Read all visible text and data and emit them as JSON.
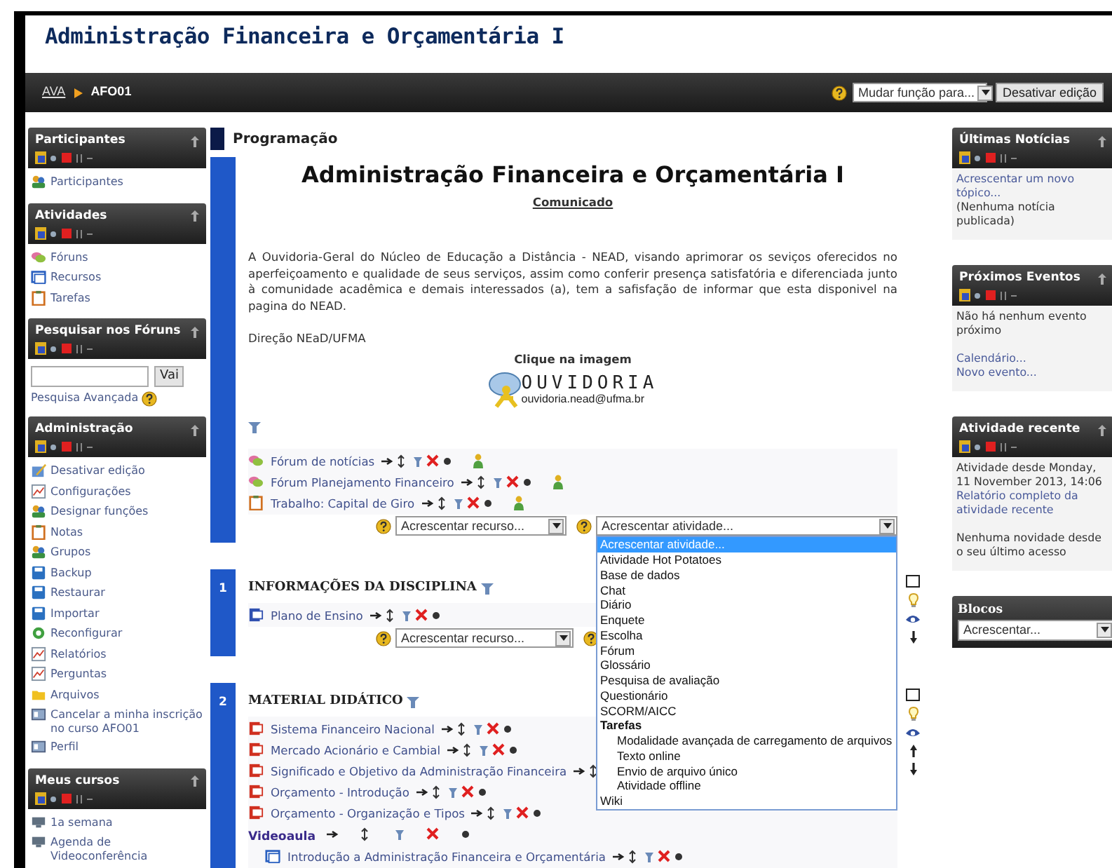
{
  "page_title": "Administração Financeira e Orçamentária I",
  "breadcrumb": [
    {
      "label": "AVA",
      "link": true
    },
    {
      "label": "AFO01",
      "link": false
    }
  ],
  "role_select": "Mudar função para...",
  "edit_button": "Desativar edição",
  "left_blocks": [
    {
      "title": "Participantes",
      "kind": "links",
      "items": [
        {
          "label": "Participantes",
          "kind": "people"
        }
      ]
    },
    {
      "title": "Atividades",
      "kind": "links",
      "items": [
        {
          "label": "Fóruns",
          "kind": "forum"
        },
        {
          "label": "Recursos",
          "kind": "resource"
        },
        {
          "label": "Tarefas",
          "kind": "clipboard"
        }
      ]
    },
    {
      "title": "Pesquisar nos Fóruns",
      "kind": "search",
      "button": "Vai",
      "link": "Pesquisa Avançada"
    },
    {
      "title": "Administração",
      "kind": "links",
      "items": [
        {
          "label": "Desativar edição",
          "kind": "pencil"
        },
        {
          "label": "Configurações",
          "kind": "chart"
        },
        {
          "label": "Designar funções",
          "kind": "people"
        },
        {
          "label": "Notas",
          "kind": "clipboard"
        },
        {
          "label": "Grupos",
          "kind": "people"
        },
        {
          "label": "Backup",
          "kind": "disk"
        },
        {
          "label": "Restaurar",
          "kind": "disk"
        },
        {
          "label": "Importar",
          "kind": "disk"
        },
        {
          "label": "Reconfigurar",
          "kind": "recycle"
        },
        {
          "label": "Relatórios",
          "kind": "chart"
        },
        {
          "label": "Perguntas",
          "kind": "chart"
        },
        {
          "label": "Arquivos",
          "kind": "folder"
        },
        {
          "label": "Cancelar a minha inscrição no curso AFO01",
          "kind": "card"
        },
        {
          "label": "Perfil",
          "kind": "card"
        }
      ]
    },
    {
      "title": "Meus cursos",
      "kind": "links",
      "items": [
        {
          "label": "1a semana",
          "kind": "monitor"
        },
        {
          "label": "Agenda de Videoconferência",
          "kind": "monitor"
        }
      ]
    }
  ],
  "section_header": "Programação",
  "intro": {
    "heading": "Administração Financeira e Orçamentária I",
    "subheading": "Comunicado",
    "paragraph": "A Ouvidoria-Geral do Núcleo de Educação a Distância - NEAD, visando aprimorar os seviços oferecidos no aperfeiçoamento e qualidade de seus serviços, assim como conferir presença satisfatória e diferenciada junto à comunidade acadêmica e demais interessados (a), tem a safisfação de informar que esta disponivel na pagina do NEAD.",
    "signature": "Direção NEaD/UFMA",
    "image_caption": "Clique na imagem",
    "logo": {
      "title": "OUVIDORIA",
      "email": "ouvidoria.nead@ufma.br"
    },
    "activities": [
      {
        "label": "Fórum de notícias",
        "kind": "forum",
        "group_icon": true
      },
      {
        "label": "Fórum Planejamento Financeiro",
        "kind": "forum",
        "group_icon": true
      },
      {
        "label": "Trabalho: Capital de Giro",
        "kind": "clipboard",
        "group_icon": true
      }
    ],
    "add_resource": "Acrescentar recurso...",
    "add_activity": {
      "value": "Acrescentar atividade...",
      "expanded": true,
      "options": [
        {
          "label": "Acrescentar atividade...",
          "selected": true
        },
        {
          "label": "Atividade Hot Potatoes",
          "selected": false
        },
        {
          "label": "Base de dados",
          "selected": false
        },
        {
          "label": "Chat",
          "selected": false
        },
        {
          "label": "Diário",
          "selected": false
        },
        {
          "label": "Enquete",
          "selected": false
        },
        {
          "label": "Escolha",
          "selected": false
        },
        {
          "label": "Fórum",
          "selected": false
        },
        {
          "label": "Glossário",
          "selected": false
        },
        {
          "label": "Pesquisa de avaliação",
          "selected": false
        },
        {
          "label": "Questionário",
          "selected": false
        },
        {
          "label": "SCORM/AICC",
          "selected": false
        },
        {
          "label": "Tarefas",
          "selected": false,
          "children": [
            {
              "label": "Modalidade avançada de carregamento de arquivos",
              "selected": false
            },
            {
              "label": "Texto online",
              "selected": false
            },
            {
              "label": "Envio de arquivo único",
              "selected": false
            },
            {
              "label": "Atividade offline",
              "selected": false
            }
          ]
        },
        {
          "label": "Wiki",
          "selected": false
        }
      ]
    }
  },
  "sections": [
    {
      "number": "1",
      "title": "INFORMAÇÕES DA DISCIPLINA",
      "can_move_up": false,
      "activities": [
        {
          "kind": "word",
          "label": "Plano de Ensino",
          "group_icon": false
        }
      ],
      "add_resource": "Acrescentar recurso..."
    },
    {
      "number": "2",
      "title": "MATERIAL DIDÁTICO",
      "can_move_up": true,
      "activities": [
        {
          "kind": "pdf",
          "label": "Sistema Financeiro Nacional",
          "group_icon": false
        },
        {
          "kind": "pdf",
          "label": "Mercado Acionário e Cambial",
          "group_icon": false
        },
        {
          "kind": "pdf",
          "label": "Significado e Objetivo da Administração Financeira",
          "group_icon": false
        },
        {
          "kind": "pdf",
          "label": "Orçamento - Introdução",
          "group_icon": false
        },
        {
          "kind": "pdf",
          "label": "Orçamento - Organização e Tipos",
          "group_icon": false
        },
        {
          "kind": "label",
          "label": "Videoaula",
          "children": [
            {
              "kind": "resource",
              "label": "Introdução a Administração Financeira e Orçamentária",
              "group_icon": false
            }
          ]
        }
      ]
    }
  ],
  "right_blocks": [
    {
      "title": "Últimas Notícias",
      "kind": "text",
      "paragraphs": [
        [
          {
            "text": "Acrescentar um novo tópico...",
            "link": true
          },
          {
            "text": "(Nenhuma notícia publicada)",
            "link": false
          }
        ]
      ]
    },
    {
      "title": "Próximos Eventos",
      "kind": "text",
      "paragraphs": [
        [
          {
            "text": "Não há nenhum evento próximo",
            "link": false
          }
        ],
        [
          {
            "text": "Calendário...",
            "link": true
          },
          {
            "text": "Novo evento...",
            "link": true
          }
        ]
      ]
    },
    {
      "title": "Atividade recente",
      "kind": "text",
      "paragraphs": [
        [
          {
            "text": "Atividade desde Monday, 11 November 2013, 14:06",
            "link": false
          },
          {
            "text": "Relatório completo da atividade recente",
            "link": true
          }
        ],
        [
          {
            "text": "Nenhuma novidade desde o seu último acesso",
            "link": false
          }
        ]
      ]
    },
    {
      "title": "Blocos",
      "kind": "select",
      "value": "Acrescentar..."
    }
  ]
}
